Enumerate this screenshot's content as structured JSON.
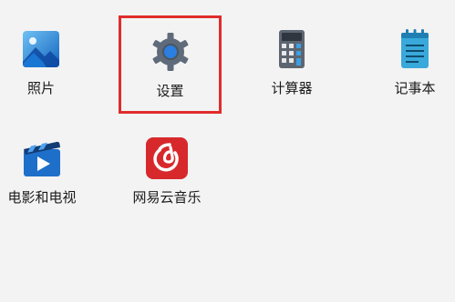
{
  "apps": {
    "photos": {
      "label": "照片",
      "icon": "photos-icon"
    },
    "settings": {
      "label": "设置",
      "icon": "gear-icon",
      "selected": true
    },
    "calc": {
      "label": "计算器",
      "icon": "calculator-icon"
    },
    "notepad": {
      "label": "记事本",
      "icon": "notepad-icon"
    },
    "movies": {
      "label": "电影和电视",
      "icon": "movies-tv-icon"
    },
    "netease": {
      "label": "网易云音乐",
      "icon": "netease-music-icon"
    }
  },
  "colors": {
    "background": "#f3f3f3",
    "highlight_border": "#e02c2c",
    "netease_red": "#d7292c",
    "photos_blue": "#1e88d8",
    "settings_gray": "#5f6b7a",
    "settings_blue": "#2a7fe0",
    "calc_gray": "#6b747e",
    "notepad_blue": "#39a9db",
    "movies_blue": "#1e6fc9"
  }
}
